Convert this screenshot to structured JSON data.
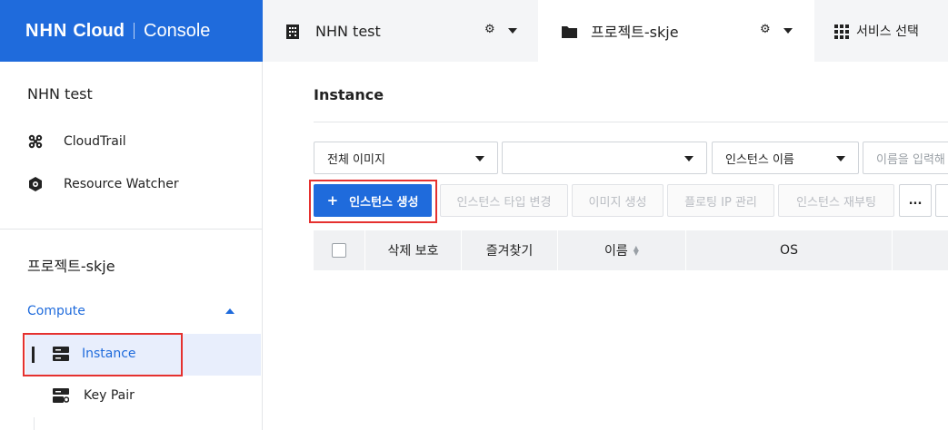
{
  "brand": {
    "logo_text": "NHN",
    "cloud": "Cloud",
    "console": "Console"
  },
  "tabs": {
    "org": {
      "label": "NHN test"
    },
    "project": {
      "label": "프로젝트-skje"
    },
    "service": {
      "label": "서비스 선택"
    }
  },
  "sidebar": {
    "org_title": "NHN test",
    "org_items": [
      {
        "label": "CloudTrail",
        "icon": "cloudtrail-icon"
      },
      {
        "label": "Resource Watcher",
        "icon": "resource-watcher-icon"
      }
    ],
    "project_title": "프로젝트-skje",
    "section": "Compute",
    "project_items": [
      {
        "label": "Instance",
        "icon": "server-icon",
        "active": true
      },
      {
        "label": "Key Pair",
        "icon": "key-pair-icon"
      }
    ]
  },
  "main": {
    "title": "Instance",
    "filters": {
      "image": "전체 이미지",
      "flavor": "",
      "search_field": "인스턴스 이름",
      "search_placeholder": "이름을 입력해"
    },
    "toolbar": {
      "create": "인스턴스 생성",
      "create_prefix": "+",
      "change_type": "인스턴스 타입 변경",
      "create_image": "이미지 생성",
      "floating_ip": "플로팅 IP 관리",
      "reboot": "인스턴스 재부팅",
      "more": "..."
    },
    "table_headers": [
      "삭제 보호",
      "즐겨찾기",
      "이름",
      "OS"
    ]
  },
  "colors": {
    "brand": "#1f6bdc",
    "highlight": "#e5312f",
    "active_bg": "#e8eefc",
    "accent_text": "#1f6bdc"
  }
}
